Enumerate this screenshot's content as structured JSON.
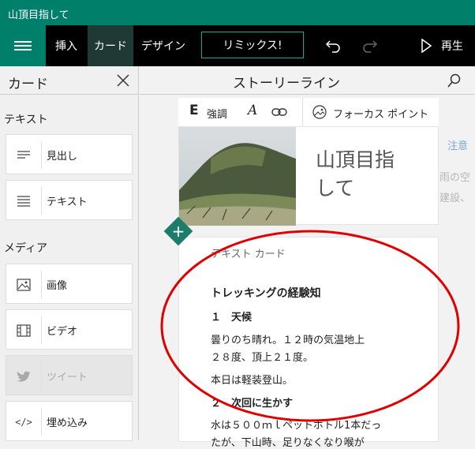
{
  "window": {
    "title": "山頂目指して"
  },
  "menubar": {
    "insert": "挿入",
    "card": "カード",
    "design": "デザイン",
    "remix": "リミックス!",
    "play": "再生"
  },
  "sidebar": {
    "title": "カード",
    "section_text": "テキスト",
    "section_media": "メディア",
    "items": [
      {
        "label": "見出し",
        "icon": "heading-icon"
      },
      {
        "label": "テキスト",
        "icon": "text-icon"
      },
      {
        "label": "画像",
        "icon": "image-icon"
      },
      {
        "label": "ビデオ",
        "icon": "video-icon"
      },
      {
        "label": "ツイート",
        "icon": "twitter-icon"
      },
      {
        "label": "埋め込み",
        "icon": "embed-icon"
      }
    ]
  },
  "main": {
    "title": "ストーリーライン",
    "toolbar": {
      "emphasis": "強調",
      "focus_point": "フォーカス ポイント"
    },
    "title_card_text_1": "山頂目指",
    "title_card_text_2": "して",
    "text_card": {
      "label": "テキスト カード",
      "heading": "トレッキングの経験知",
      "sub1": "１　天候",
      "p1a": "曇りのち晴れ。１２時の気温地上",
      "p1b": "２８度、頂上２１度。",
      "p2": "本日は軽装登山。",
      "sub2": "２　次回に生かす",
      "p3a": "水は５００ｍｌペットボトル1本だっ",
      "p3b": "たが、下山時、足りなくなり喉が"
    },
    "background_fragments": {
      "f1": "注意",
      "f2": "雨の空",
      "f3": "建設、"
    }
  },
  "annotation": {
    "color": "#e00000"
  }
}
